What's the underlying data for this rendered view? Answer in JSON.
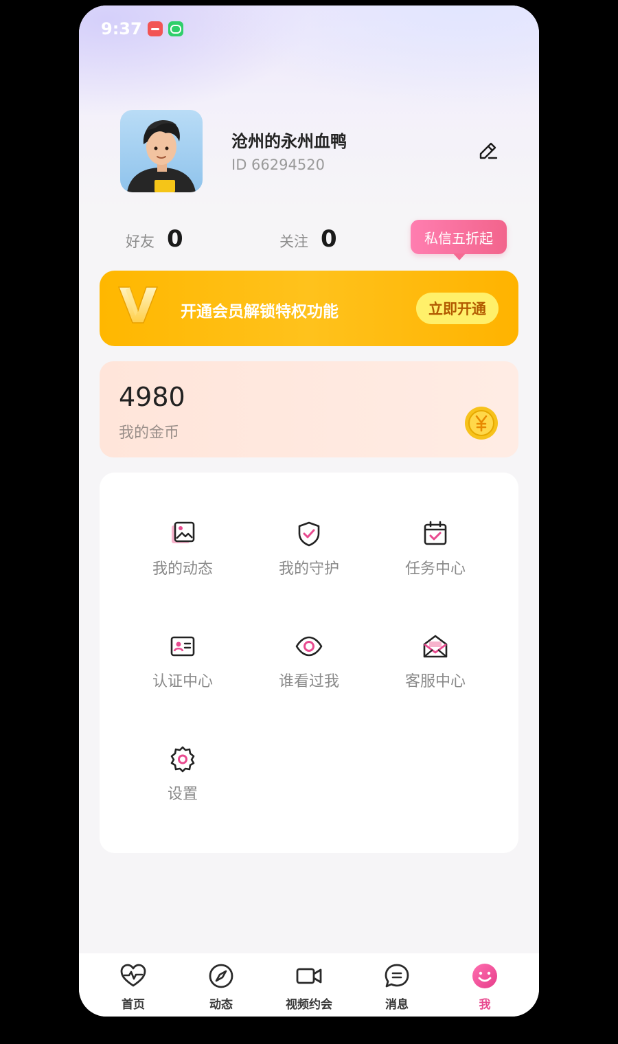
{
  "status_bar": {
    "time": "9:37"
  },
  "profile": {
    "username": "沧州的永州血鸭",
    "id": "ID 66294520"
  },
  "stats": {
    "friends_label": "好友",
    "friends_value": "0",
    "follow_label": "关注",
    "follow_value": "0",
    "promo_tag": "私信五折起"
  },
  "vip_banner": {
    "text": "开通会员解锁特权功能",
    "button": "立即开通"
  },
  "coins": {
    "value": "4980",
    "label": "我的金币"
  },
  "menu": {
    "items": [
      {
        "label": "我的动态",
        "icon": "gallery-icon"
      },
      {
        "label": "我的守护",
        "icon": "shield-check-icon"
      },
      {
        "label": "任务中心",
        "icon": "calendar-check-icon"
      },
      {
        "label": "认证中心",
        "icon": "id-card-icon"
      },
      {
        "label": "谁看过我",
        "icon": "eye-icon"
      },
      {
        "label": "客服中心",
        "icon": "mail-open-icon"
      },
      {
        "label": "设置",
        "icon": "gear-icon"
      }
    ]
  },
  "tabbar": {
    "items": [
      {
        "label": "首页",
        "icon": "heartbeat-icon"
      },
      {
        "label": "动态",
        "icon": "compass-icon"
      },
      {
        "label": "视频约会",
        "icon": "video-camera-icon"
      },
      {
        "label": "消息",
        "icon": "chat-bubble-icon"
      },
      {
        "label": "我",
        "icon": "smiley-icon"
      }
    ],
    "active_index": 4
  },
  "colors": {
    "accent_pink": "#e84a8f",
    "vip_orange": "#ffb700",
    "coin_gold": "#f5b800"
  }
}
